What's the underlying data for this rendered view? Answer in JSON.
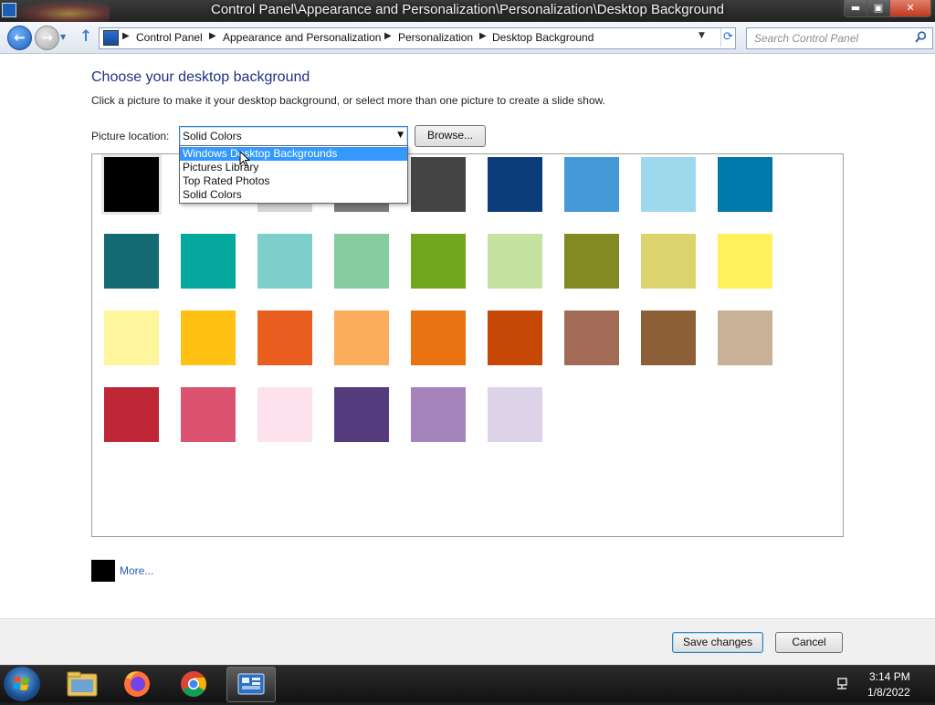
{
  "window": {
    "title": "Control Panel\\Appearance and Personalization\\Personalization\\Desktop Background",
    "min_glyph": "▬",
    "max_glyph": "▣",
    "close_glyph": "✕"
  },
  "nav": {
    "back_glyph": "←",
    "forward_glyph": "→",
    "up_glyph": "↑",
    "breadcrumbs": [
      "Control Panel",
      "Appearance and Personalization",
      "Personalization",
      "Desktop Background"
    ],
    "breadcrumb_separator": "▶",
    "refresh_glyph": "⟳",
    "search_placeholder": "Search Control Panel",
    "search_icon": "search-icon"
  },
  "main": {
    "heading": "Choose your desktop background",
    "description": "Click a picture to make it your desktop background, or select more than one picture to create a slide show.",
    "picture_location_label": "Picture location:",
    "picture_location_value": "Solid Colors",
    "browse_label": "Browse...",
    "dropdown_options": [
      "Windows Desktop Backgrounds",
      "Pictures Library",
      "Top Rated Photos",
      "Solid Colors"
    ],
    "dropdown_highlighted": "Windows Desktop Backgrounds",
    "colors": [
      [
        "#000000",
        "#ffffff",
        "#d4d4d4",
        "#7a7a7a",
        "#444444",
        "#0d3c7a",
        "#4599d6",
        "#9dd9ec",
        "#0078ab"
      ],
      [
        "#136a72",
        "#05a89c",
        "#7ecfcc",
        "#87cc9e",
        "#72a61c",
        "#c6e2a0",
        "#828a21",
        "#dcd36c",
        "#fff15c"
      ],
      [
        "#fff59c",
        "#ffc113",
        "#e95e1f",
        "#fbad5b",
        "#e87310",
        "#c74707",
        "#a16b56",
        "#8c5f36",
        "#c8b197"
      ],
      [
        "#bf2737",
        "#dc5271",
        "#fde1ed",
        "#553c7e",
        "#a584bc",
        "#dcd3e8"
      ]
    ],
    "selected_color": "#000000",
    "more_label": "More...",
    "more_swatch_color": "#000000"
  },
  "footer": {
    "save_label": "Save changes",
    "cancel_label": "Cancel"
  },
  "taskbar": {
    "time": "3:14 PM",
    "date": "1/8/2022",
    "items": [
      "file-explorer-icon",
      "firefox-icon",
      "chrome-icon",
      "control-panel-icon"
    ]
  }
}
